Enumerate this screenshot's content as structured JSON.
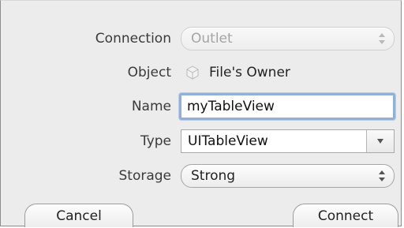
{
  "form": {
    "connection": {
      "label": "Connection",
      "value": "Outlet"
    },
    "object": {
      "label": "Object",
      "value": "File's Owner",
      "icon": "cube-icon"
    },
    "name": {
      "label": "Name",
      "value": "myTableView"
    },
    "type": {
      "label": "Type",
      "value": "UITableView"
    },
    "storage": {
      "label": "Storage",
      "value": "Strong"
    }
  },
  "buttons": {
    "cancel_label": "Cancel",
    "connect_label": "Connect"
  }
}
